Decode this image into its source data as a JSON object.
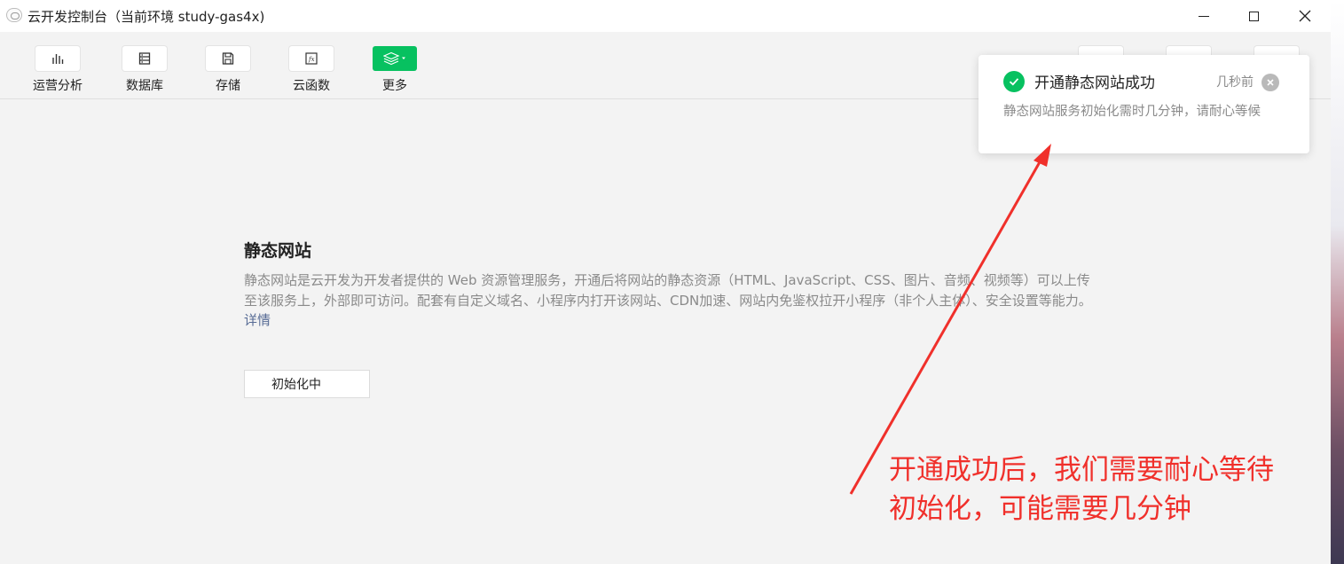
{
  "window": {
    "title": "云开发控制台（当前环境 study-gas4x)"
  },
  "toolbar": {
    "items": [
      {
        "label": "运营分析",
        "icon": "bar-chart-icon"
      },
      {
        "label": "数据库",
        "icon": "database-icon"
      },
      {
        "label": "存储",
        "icon": "save-disk-icon"
      },
      {
        "label": "云函数",
        "icon": "function-icon"
      },
      {
        "label": "更多",
        "icon": "layers-icon"
      }
    ]
  },
  "main": {
    "title": "静态网站",
    "description": "静态网站是云开发为开发者提供的 Web 资源管理服务，开通后将网站的静态资源（HTML、JavaScript、CSS、图片、音频、视频等）可以上传至该服务上，外部即可访问。配套有自定义域名、小程序内打开该网站、CDN加速、网站内免鉴权拉开小程序（非个人主体）、安全设置等能力。",
    "detail_link": "详情",
    "init_button": "初始化中"
  },
  "notification": {
    "title": "开通静态网站成功",
    "time": "几秒前",
    "body": "静态网站服务初始化需时几分钟，请耐心等候"
  },
  "annotation": {
    "line1": "开通成功后，我们需要耐心等待",
    "line2": "初始化，可能需要几分钟",
    "color": "#f0302b"
  },
  "colors": {
    "accent": "#07c160",
    "link": "#576b95"
  }
}
